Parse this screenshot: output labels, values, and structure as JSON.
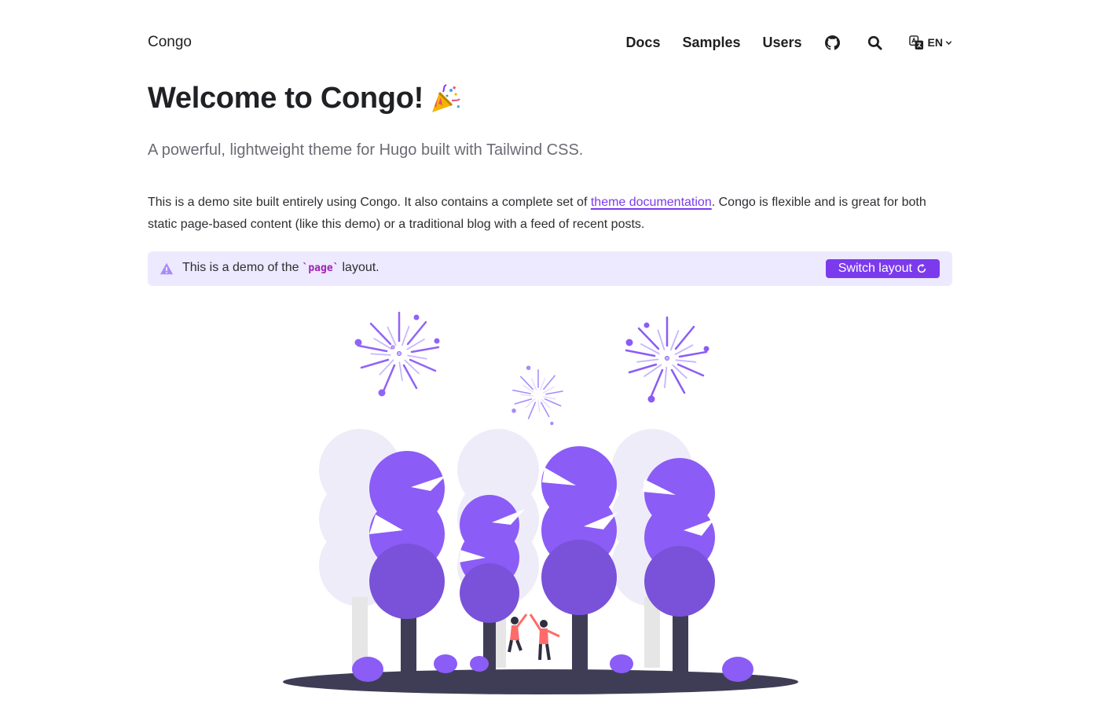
{
  "header": {
    "brand": "Congo",
    "nav": [
      {
        "label": "Docs"
      },
      {
        "label": "Samples"
      },
      {
        "label": "Users"
      }
    ],
    "icons": [
      "github-icon",
      "search-icon",
      "translate-icon"
    ],
    "language": "EN"
  },
  "main": {
    "title": "Welcome to Congo!",
    "title_emoji_icon": "party-popper-icon",
    "lead": "A powerful, lightweight theme for Hugo built with Tailwind CSS.",
    "body_before_link": "This is a demo site built entirely using Congo. It also contains a complete set of ",
    "body_link": "theme documentation",
    "body_after_link": ". Congo is flexible and is great for both static page-based content (like this demo) or a traditional blog with a feed of recent posts."
  },
  "alert": {
    "icon": "warning-triangle-icon",
    "text_before": "This is a demo of the",
    "code": "`page`",
    "text_after": "layout.",
    "button_label": "Switch layout",
    "button_icon": "refresh-icon"
  },
  "colors": {
    "accent": "#7c3aed",
    "alert_bg": "#ede9fe",
    "tree_purple": "#8b5cf6",
    "tree_dark": "#7952d9",
    "tree_light": "#efecf9",
    "ground": "#3f3d56"
  }
}
